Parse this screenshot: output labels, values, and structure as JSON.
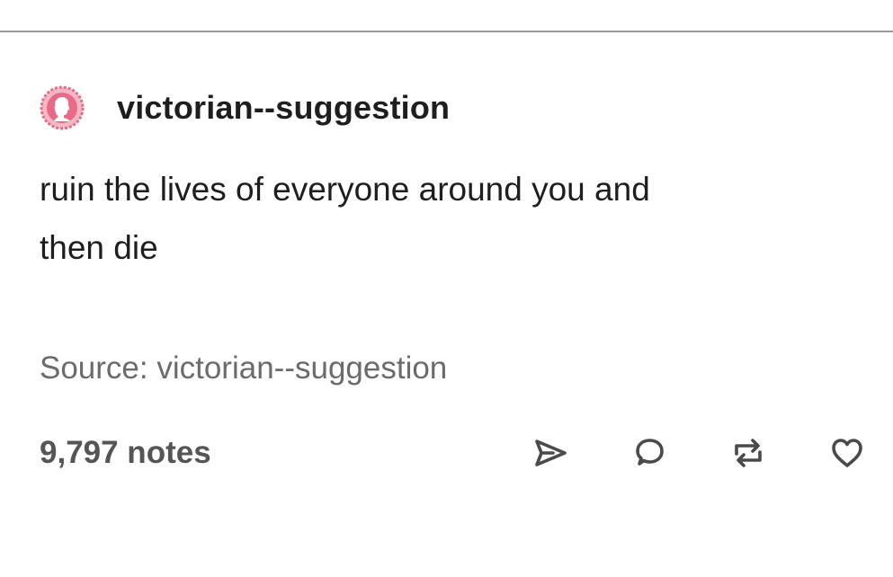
{
  "post": {
    "blog_name": "victorian--suggestion",
    "body_lines": [
      "ruin the lives of everyone around you and",
      "then die"
    ],
    "source_text": "Source: victorian--suggestion",
    "notes_text": "9,797 notes"
  },
  "actions": {
    "share_icon": "paper-plane-icon",
    "reply_icon": "speech-bubble-icon",
    "reblog_icon": "reblog-arrows-icon",
    "like_icon": "heart-icon"
  },
  "colors": {
    "avatar_pink": "#e86a87",
    "text": "#1e1e1e",
    "muted": "#6b6b6b",
    "divider": "#9a9a9a"
  }
}
